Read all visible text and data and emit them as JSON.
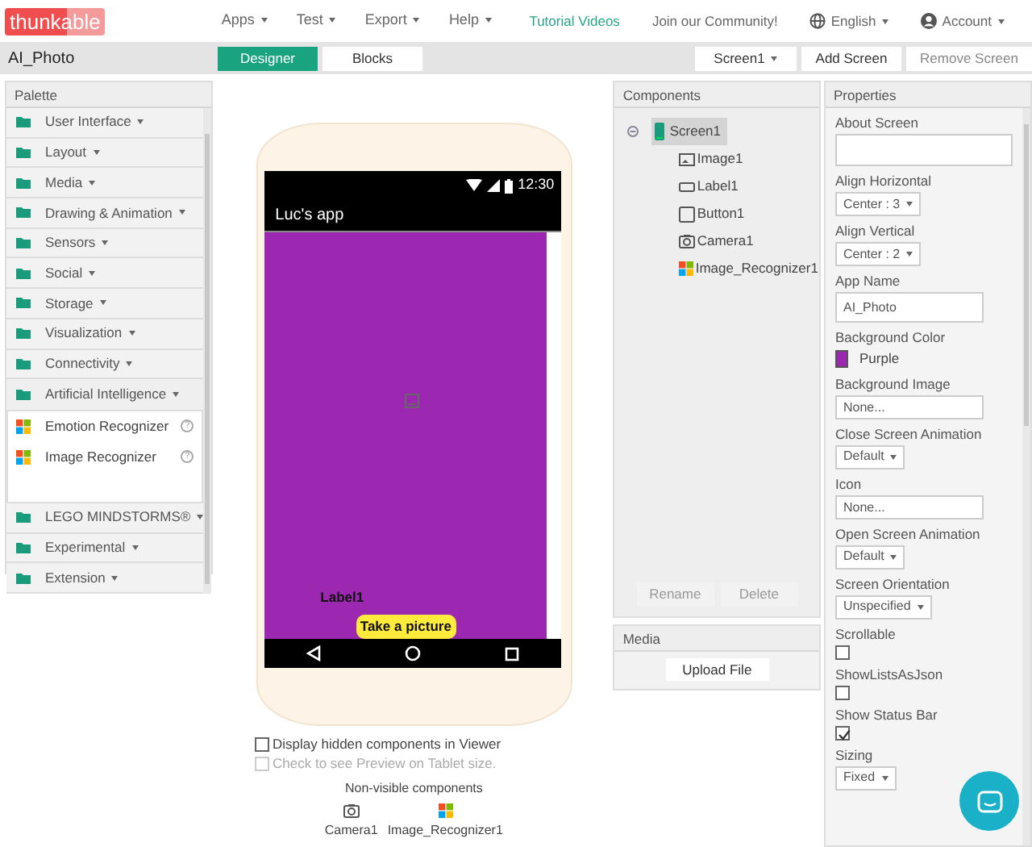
{
  "app_bar": {
    "logo": "thunkable",
    "menus": [
      "Apps",
      "Test",
      "Export",
      "Help"
    ],
    "links": [
      "Tutorial Videos",
      "Join our Community!"
    ],
    "language": "English",
    "account": "Account"
  },
  "project_bar": {
    "project_name": "AI_Photo",
    "tabs": [
      {
        "label": "Designer",
        "selected": true
      },
      {
        "label": "Blocks",
        "selected": false
      }
    ],
    "screen_select": "Screen1",
    "buttons": [
      {
        "label": "Add Screen",
        "disabled": false
      },
      {
        "label": "Remove Screen",
        "disabled": true
      }
    ]
  },
  "palette": {
    "title": "Palette",
    "categories": [
      {
        "label": "User Interface",
        "expanded": false
      },
      {
        "label": "Layout",
        "expanded": false
      },
      {
        "label": "Media",
        "expanded": false
      },
      {
        "label": "Drawing & Animation",
        "expanded": false
      },
      {
        "label": "Sensors",
        "expanded": false
      },
      {
        "label": "Social",
        "expanded": false
      },
      {
        "label": "Storage",
        "expanded": false
      },
      {
        "label": "Visualization",
        "expanded": false
      },
      {
        "label": "Connectivity",
        "expanded": false
      },
      {
        "label": "Artificial Intelligence",
        "expanded": true,
        "children": [
          {
            "label": "Emotion Recognizer",
            "help": "?"
          },
          {
            "label": "Image Recognizer",
            "help": "?"
          }
        ]
      },
      {
        "label": "LEGO MINDSTORMS®",
        "expanded": false
      },
      {
        "label": "Experimental",
        "expanded": false
      },
      {
        "label": "Extension",
        "expanded": false
      }
    ]
  },
  "viewer": {
    "phone": {
      "time": "12:30",
      "title": "Luc's app",
      "label": "Label1",
      "button": "Take a picture"
    },
    "options": [
      {
        "label": "Display hidden components in Viewer",
        "checked": false,
        "disabled": false
      },
      {
        "label": "Check to see Preview on Tablet size.",
        "checked": false,
        "disabled": true
      }
    ],
    "non_visible": {
      "title": "Non-visible components",
      "items": [
        {
          "label": "Camera1",
          "kind": "camera"
        },
        {
          "label": "Image_Recognizer1",
          "kind": "recognizer"
        }
      ]
    }
  },
  "components": {
    "title": "Components",
    "root": {
      "label": "Screen1",
      "selected": true,
      "expanded": true,
      "children": [
        {
          "label": "Image1",
          "kind": "image"
        },
        {
          "label": "Label1",
          "kind": "label"
        },
        {
          "label": "Button1",
          "kind": "button"
        },
        {
          "label": "Camera1",
          "kind": "camera"
        },
        {
          "label": "Image_Recognizer1",
          "kind": "recognizer"
        }
      ]
    },
    "buttons": [
      {
        "label": "Rename",
        "disabled": true
      },
      {
        "label": "Delete",
        "disabled": true
      }
    ]
  },
  "media": {
    "title": "Media",
    "button": "Upload File"
  },
  "properties": {
    "title": "Properties",
    "items": [
      {
        "label": "About Screen",
        "kind": "textarea"
      },
      {
        "label": "Align Horizontal",
        "kind": "select",
        "value": "Center : 3"
      },
      {
        "label": "Align Vertical",
        "kind": "select",
        "value": "Center : 2"
      },
      {
        "label": "App Name",
        "kind": "input",
        "value": "AI_Photo"
      },
      {
        "label": "Background Color",
        "kind": "color",
        "value": "Purple",
        "color": "#9c27b0"
      },
      {
        "label": "Background Image",
        "kind": "input",
        "value": "None..."
      },
      {
        "label": "Close Screen Animation",
        "kind": "select",
        "value": "Default"
      },
      {
        "label": "Icon",
        "kind": "input",
        "value": "None..."
      },
      {
        "label": "Open Screen Animation",
        "kind": "select",
        "value": "Default"
      },
      {
        "label": "Screen Orientation",
        "kind": "select",
        "value": "Unspecified"
      },
      {
        "label": "Scrollable",
        "kind": "checkbox",
        "checked": false
      },
      {
        "label": "ShowListsAsJson",
        "kind": "checkbox",
        "checked": false
      },
      {
        "label": "Show Status Bar",
        "kind": "checkbox",
        "checked": true
      },
      {
        "label": "Sizing",
        "kind": "select",
        "value": "Fixed"
      }
    ]
  }
}
